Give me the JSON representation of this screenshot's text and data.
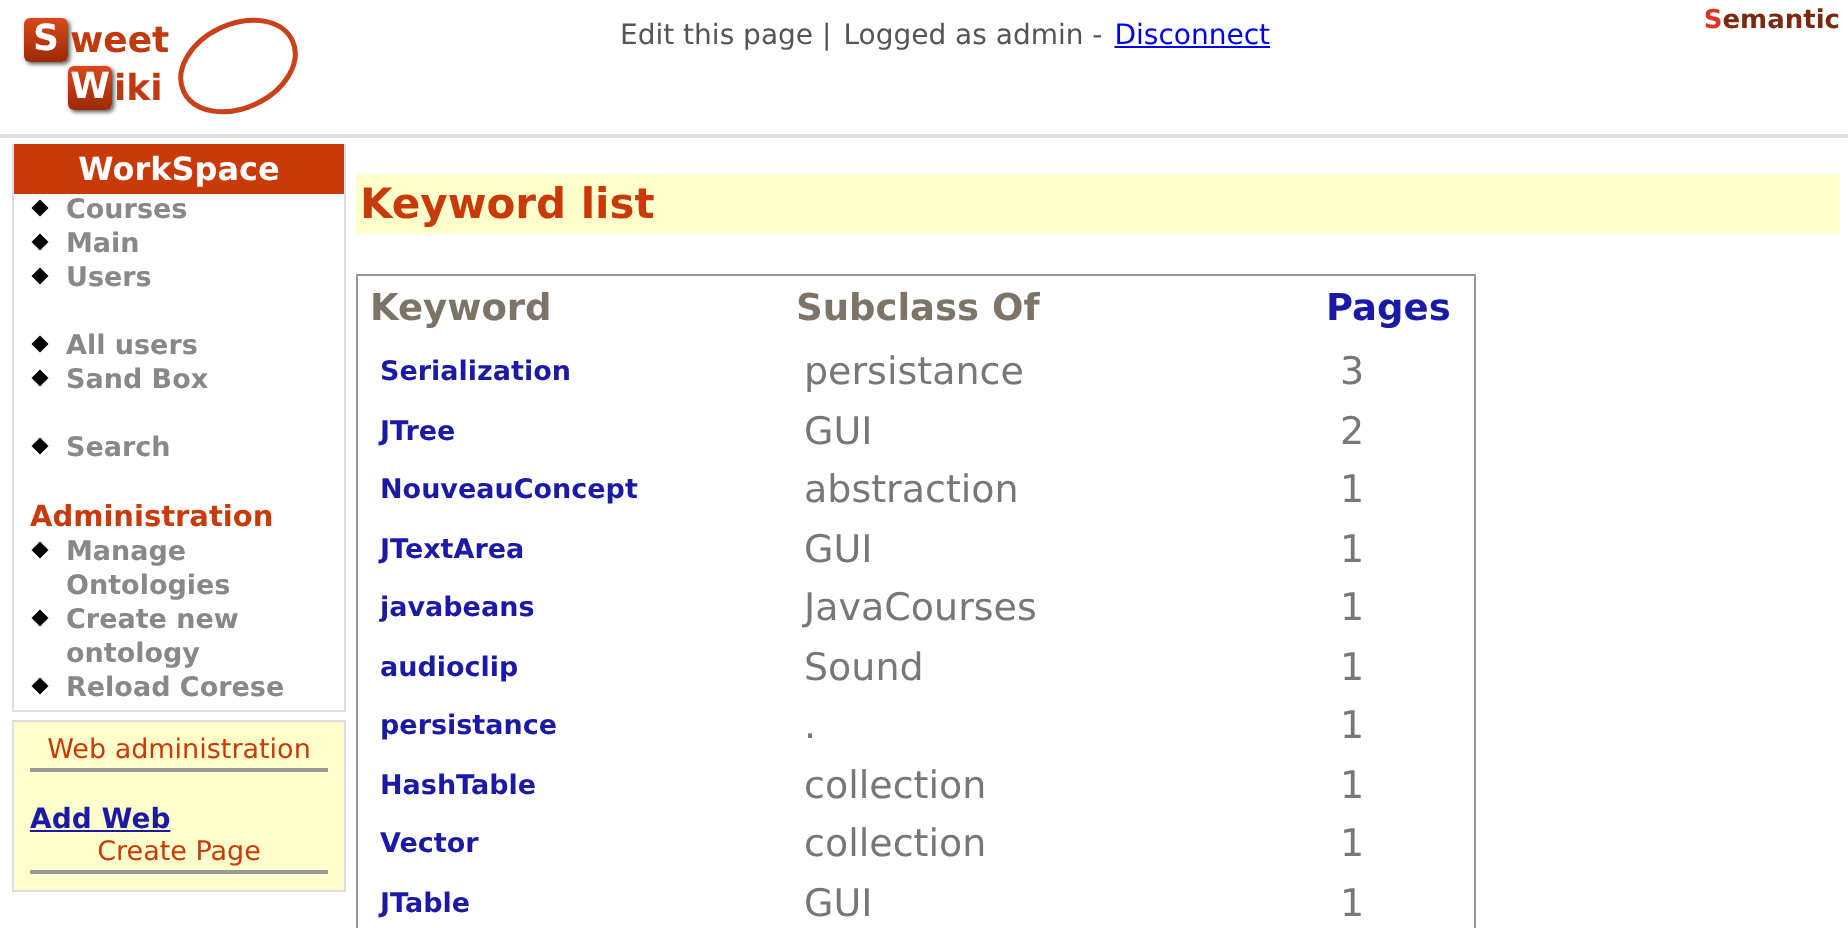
{
  "logo": {
    "lines": [
      {
        "initial": "S",
        "rest": "weet"
      },
      {
        "initial": "W",
        "rest": "iki"
      }
    ]
  },
  "topbar": {
    "edit": "Edit this page |",
    "logged": "Logged as admin -",
    "disconnect": "Disconnect"
  },
  "brand": {
    "initial": "S",
    "rest": "emantic"
  },
  "sidebar": {
    "title": "WorkSpace",
    "groups": [
      {
        "items": [
          "Courses",
          "Main",
          "Users"
        ]
      },
      {
        "items": [
          "All users",
          "Sand Box"
        ]
      },
      {
        "items": [
          "Search"
        ]
      },
      {
        "heading": "Administration",
        "items": [
          "Manage Ontologies",
          "Create new ontology",
          "Reload Corese"
        ]
      }
    ],
    "admin": {
      "heading": "Web administration",
      "link": "Add Web",
      "action": "Create Page"
    }
  },
  "page_title": "Keyword list",
  "table": {
    "columns": [
      "Keyword",
      "Subclass Of",
      "Pages"
    ],
    "rows": [
      {
        "keyword": "Serialization",
        "subclass_of": "persistance",
        "pages": "3"
      },
      {
        "keyword": "JTree",
        "subclass_of": "GUI",
        "pages": "2"
      },
      {
        "keyword": "NouveauConcept",
        "subclass_of": "abstraction",
        "pages": "1"
      },
      {
        "keyword": "JTextArea",
        "subclass_of": "GUI",
        "pages": "1"
      },
      {
        "keyword": "javabeans",
        "subclass_of": "JavaCourses",
        "pages": "1"
      },
      {
        "keyword": "audioclip",
        "subclass_of": "Sound",
        "pages": "1"
      },
      {
        "keyword": "persistance",
        "subclass_of": ".",
        "pages": "1"
      },
      {
        "keyword": "HashTable",
        "subclass_of": "collection",
        "pages": "1"
      },
      {
        "keyword": "Vector",
        "subclass_of": "collection",
        "pages": "1"
      },
      {
        "keyword": "JTable",
        "subclass_of": "GUI",
        "pages": "1"
      }
    ]
  }
}
